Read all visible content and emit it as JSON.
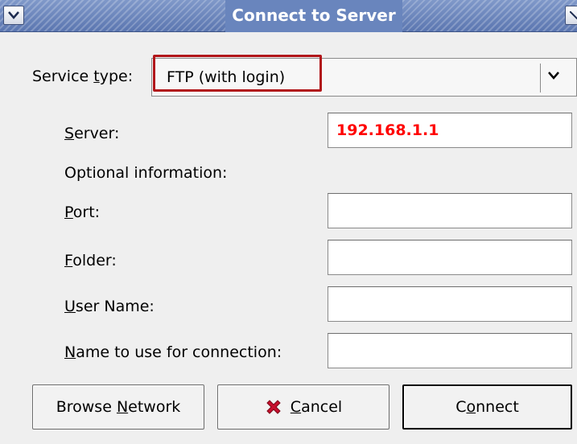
{
  "window": {
    "title": "Connect to Server"
  },
  "service": {
    "label_pre": "Service ",
    "label_mnemonic": "t",
    "label_post": "ype:",
    "selected": "FTP (with login)"
  },
  "fields": {
    "server": {
      "label_mnemonic": "S",
      "label_rest": "erver:",
      "value": "192.168.1.1"
    },
    "optional_info": "Optional information:",
    "port": {
      "label_mnemonic": "P",
      "label_rest": "ort:",
      "value": ""
    },
    "folder": {
      "label_mnemonic": "F",
      "label_rest": "older:",
      "value": ""
    },
    "username": {
      "label_mnemonic": "U",
      "label_rest": "ser Name:",
      "value": ""
    },
    "connection_name": {
      "label_mnemonic": "N",
      "label_rest": "ame to use for connection:",
      "value": ""
    }
  },
  "buttons": {
    "browse": {
      "pre": "Browse ",
      "mnemonic": "N",
      "post": "etwork"
    },
    "cancel": {
      "mnemonic": "C",
      "post": "ancel",
      "icon": "cancel-x-icon"
    },
    "connect": {
      "pre": "C",
      "mnemonic": "o",
      "post": "nnect"
    }
  },
  "colors": {
    "highlight_border": "#b1161a",
    "server_text": "#ff0000",
    "cancel_icon": "#c8102e"
  }
}
